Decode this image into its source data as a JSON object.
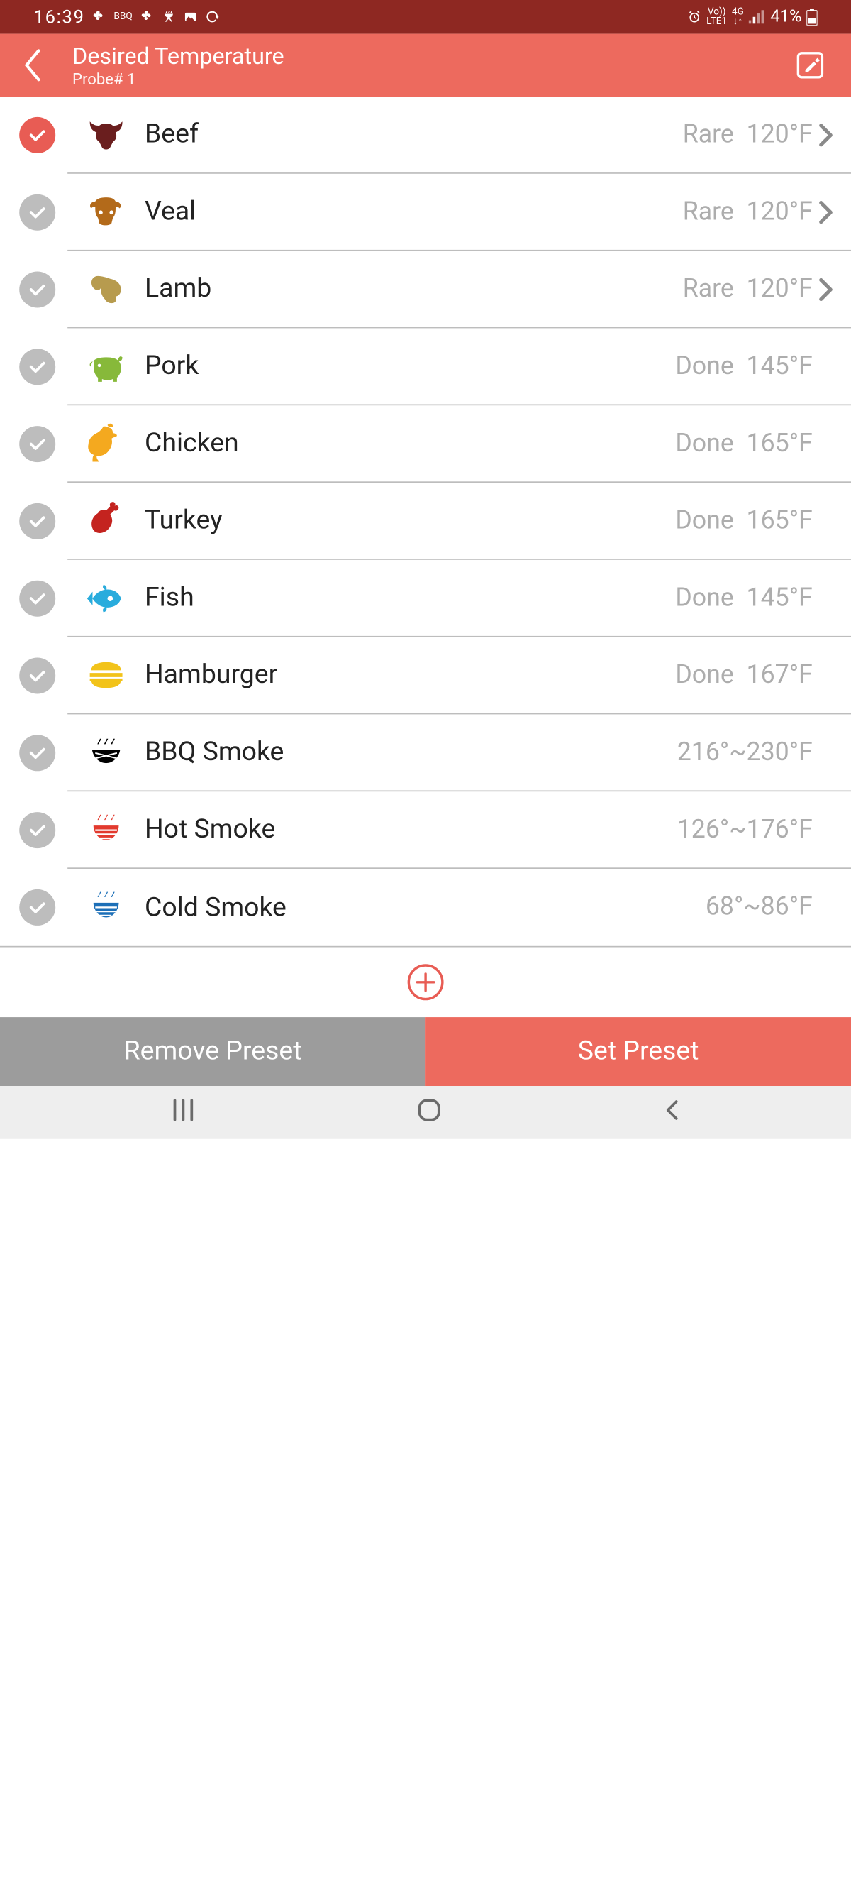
{
  "status": {
    "time": "16:39",
    "bbq_text": "BBQ",
    "net1": "Vo))",
    "net2": "LTE1",
    "net3": "4G",
    "battery": "41%"
  },
  "header": {
    "title": "Desired Temperature",
    "subtitle": "Probe# 1"
  },
  "items": [
    {
      "name": "Beef",
      "value": "Rare  120°F",
      "selected": true,
      "chevron": true,
      "icon": "bull-icon",
      "color": "#6a1e1e"
    },
    {
      "name": "Veal",
      "value": "Rare  120°F",
      "selected": false,
      "chevron": true,
      "icon": "cow-icon",
      "color": "#b36a1a"
    },
    {
      "name": "Lamb",
      "value": "Rare  120°F",
      "selected": false,
      "chevron": true,
      "icon": "ram-icon",
      "color": "#b79b4e"
    },
    {
      "name": "Pork",
      "value": "Done  145°F",
      "selected": false,
      "chevron": false,
      "icon": "pig-icon",
      "color": "#87b93a"
    },
    {
      "name": "Chicken",
      "value": "Done  165°F",
      "selected": false,
      "chevron": false,
      "icon": "rooster-icon",
      "color": "#f4a91f"
    },
    {
      "name": "Turkey",
      "value": "Done  165°F",
      "selected": false,
      "chevron": false,
      "icon": "drumstick-icon",
      "color": "#c4231f"
    },
    {
      "name": "Fish",
      "value": "Done  145°F",
      "selected": false,
      "chevron": false,
      "icon": "fish-icon",
      "color": "#29acdd"
    },
    {
      "name": "Hamburger",
      "value": "Done  167°F",
      "selected": false,
      "chevron": false,
      "icon": "burger-icon",
      "color": "#f2c31a"
    },
    {
      "name": "BBQ Smoke",
      "value": "216°~230°F",
      "selected": false,
      "chevron": false,
      "icon": "bbq-smoke-icon",
      "color": "#f07a1e"
    },
    {
      "name": "Hot Smoke",
      "value": "126°~176°F",
      "selected": false,
      "chevron": false,
      "icon": "hot-smoke-icon",
      "color": "#e23a2e"
    },
    {
      "name": "Cold Smoke",
      "value": "68°~86°F",
      "selected": false,
      "chevron": false,
      "icon": "cold-smoke-icon",
      "color": "#1c6fb7"
    }
  ],
  "buttons": {
    "remove": "Remove Preset",
    "set": "Set Preset"
  }
}
